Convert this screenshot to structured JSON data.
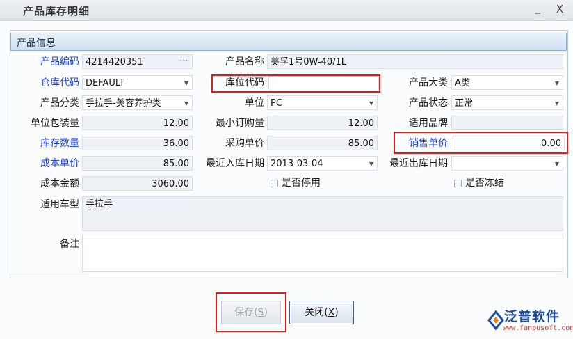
{
  "window": {
    "title": "产品库存明细",
    "minimize_label": "_",
    "close_label": "X"
  },
  "section_title": "产品信息",
  "fields": {
    "product_code": {
      "label": "产品编码",
      "value": "4214420351",
      "ellipsis": "···"
    },
    "product_name": {
      "label": "产品名称",
      "value": "美孚1号0W-40/1L"
    },
    "warehouse_code": {
      "label": "仓库代码",
      "value": "DEFAULT"
    },
    "location_code": {
      "label": "库位代码",
      "value": ""
    },
    "product_category_main": {
      "label": "产品大类",
      "value": "A类"
    },
    "product_classification": {
      "label": "产品分类",
      "value": "手拉手-美容养护类"
    },
    "unit": {
      "label": "单位",
      "value": "PC"
    },
    "product_status": {
      "label": "产品状态",
      "value": "正常"
    },
    "unit_pack_qty": {
      "label": "单位包装量",
      "value": "12.00"
    },
    "min_order_qty": {
      "label": "最小订购量",
      "value": "12.00"
    },
    "applicable_brand": {
      "label": "适用品牌",
      "value": ""
    },
    "stock_qty": {
      "label": "库存数量",
      "value": "36.00"
    },
    "purchase_price": {
      "label": "采购单价",
      "value": "85.00"
    },
    "sale_price": {
      "label": "销售单价",
      "value": "0.00"
    },
    "cost_price": {
      "label": "成本单价",
      "value": "85.00"
    },
    "last_in_date": {
      "label": "最近入库日期",
      "value": "2013-03-04"
    },
    "last_out_date": {
      "label": "最近出库日期",
      "value": ""
    },
    "cost_amount": {
      "label": "成本金额",
      "value": "3060.00"
    },
    "is_disabled": {
      "label": "是否停用",
      "checked": false
    },
    "is_frozen": {
      "label": "是否冻结",
      "checked": false
    },
    "applicable_model": {
      "label": "适用车型",
      "value": "手拉手"
    },
    "remark": {
      "label": "备注",
      "value": ""
    }
  },
  "buttons": {
    "save": "保存(S)",
    "save_prefix": "保存(",
    "save_key": "S",
    "close_prefix": "关闭(",
    "close_key": "X",
    "suffix": ")"
  },
  "logo": {
    "name": "泛普软件",
    "url": "www.fanpusoft.com"
  },
  "colors": {
    "highlight": "#e01b1b",
    "required_label": "#1a3cd8",
    "brand": "#1b4ea0"
  }
}
